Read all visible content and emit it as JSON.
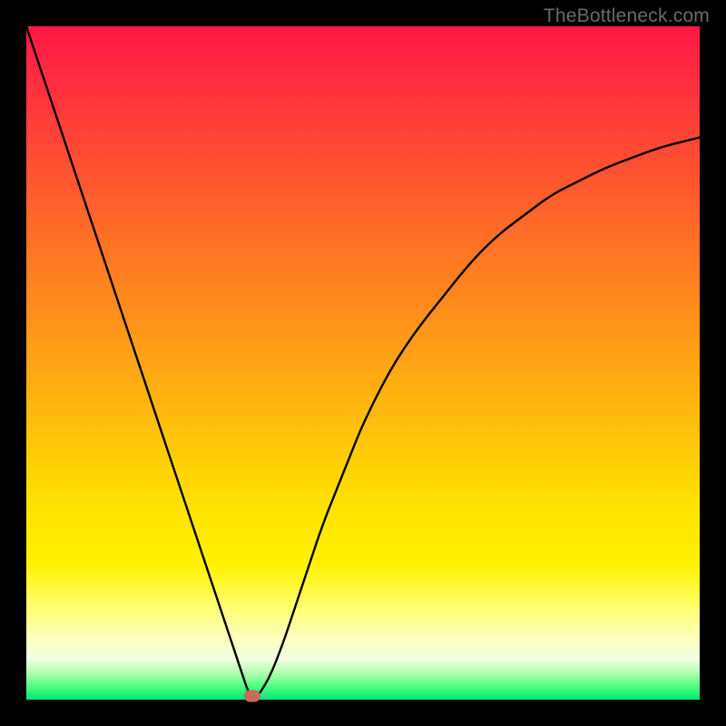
{
  "watermark": "TheBottleneck.com",
  "chart_data": {
    "type": "line",
    "title": "",
    "xlabel": "",
    "ylabel": "",
    "xlim": [
      0,
      100
    ],
    "ylim": [
      0,
      100
    ],
    "grid": false,
    "legend": false,
    "background_gradient": {
      "top_color": "#ff1744",
      "mid_color": "#ffe400",
      "bottom_color": "#00e676",
      "meaning": "red=high bottleneck, green=low bottleneck"
    },
    "series": [
      {
        "name": "bottleneck-curve",
        "color": "#000000",
        "x": [
          0,
          2,
          4,
          6,
          8,
          10,
          12,
          14,
          16,
          18,
          20,
          22,
          24,
          26,
          28,
          30,
          32,
          33,
          34,
          36,
          38,
          40,
          42,
          44,
          46,
          48,
          50,
          54,
          58,
          62,
          66,
          70,
          74,
          78,
          82,
          86,
          90,
          94,
          98,
          100
        ],
        "y": [
          100,
          94,
          88,
          82,
          76,
          70,
          64,
          58,
          52,
          46,
          40,
          34,
          28,
          22,
          16,
          10,
          4,
          1,
          0,
          3,
          8,
          14,
          20,
          26,
          31,
          36,
          41,
          49,
          55,
          60,
          65,
          69,
          72,
          75,
          77,
          79,
          80.5,
          82,
          83,
          83.5
        ]
      }
    ],
    "marker": {
      "name": "optimal-point",
      "x": 33.5,
      "y": 0.5,
      "color": "#c96a5a"
    }
  }
}
